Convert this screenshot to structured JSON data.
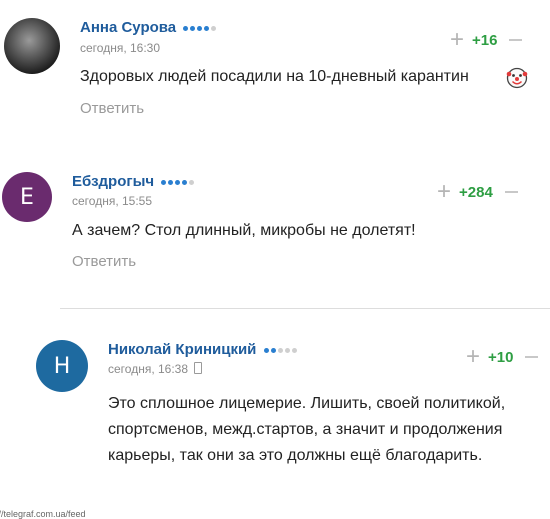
{
  "comments": [
    {
      "author": "Анна Сурова",
      "time": "сегодня, 16:30",
      "text": "Здоровых людей посадили на 10-дневный карантин",
      "reply": "Ответить",
      "score": "+16",
      "avatar_letter": "",
      "rating_dots": 4
    },
    {
      "author": "Ебздрогыч",
      "time": "сегодня, 15:55",
      "text": "А зачем? Стол длинный, микробы не долетят!",
      "reply": "Ответить",
      "score": "+284",
      "avatar_letter": "Е",
      "avatar_color": "#6a2b6e",
      "rating_dots": 4
    },
    {
      "author": "Николай Криницкий",
      "time": "сегодня, 16:38",
      "text": "Это сплошное лицемерие. Лишить, своей политикой, спортсменов, межд.стартов, а значит и продолжения карьеры, так они за это должны ещё благодарить.",
      "score": "+10",
      "avatar_letter": "Н",
      "avatar_color": "#1e6aa0",
      "rating_dots": 2
    }
  ],
  "colors": {
    "author": "#1f5c9c",
    "score_positive": "#2e9e43",
    "dot_active": "#2a7fd0",
    "dot_inactive": "#cfcfcf"
  },
  "icons": {
    "emoji": "clown-face-icon",
    "device": "phone-icon"
  },
  "footer_url": "://telegraf.com.ua/feed"
}
